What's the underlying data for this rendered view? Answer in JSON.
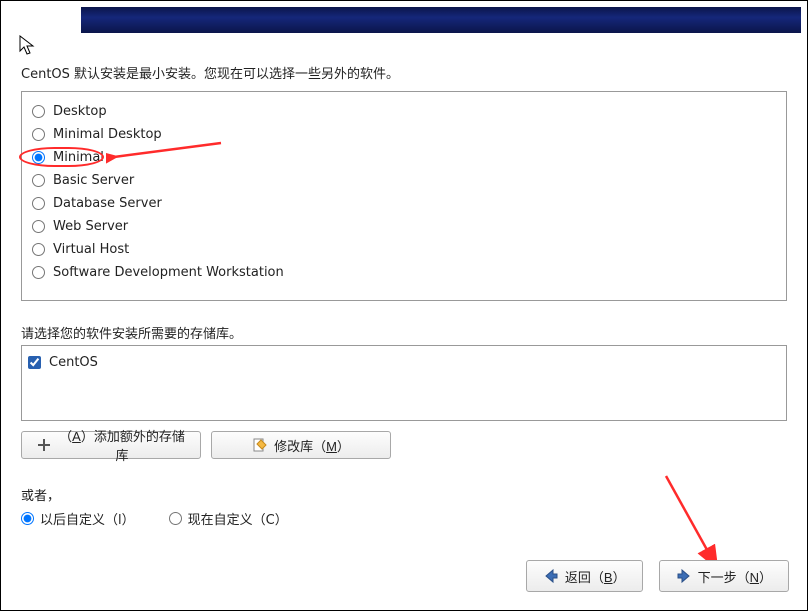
{
  "intro": "CentOS 默认安装是最小安装。您现在可以选择一些另外的软件。",
  "software_options": [
    {
      "label": "Desktop",
      "selected": false
    },
    {
      "label": "Minimal Desktop",
      "selected": false
    },
    {
      "label": "Minimal",
      "selected": true
    },
    {
      "label": "Basic Server",
      "selected": false
    },
    {
      "label": "Database Server",
      "selected": false
    },
    {
      "label": "Web Server",
      "selected": false
    },
    {
      "label": "Virtual Host",
      "selected": false
    },
    {
      "label": "Software Development Workstation",
      "selected": false
    }
  ],
  "repo_label": "请选择您的软件安装所需要的存储库。",
  "repos": [
    {
      "label": "CentOS",
      "checked": true
    }
  ],
  "add_repo_btn_prefix": "（",
  "add_repo_btn_key": "A",
  "add_repo_btn_suffix": "）添加额外的存储库",
  "modify_repo_btn_prefix": "修改库（",
  "modify_repo_btn_key": "M",
  "modify_repo_btn_suffix": "）",
  "or_label": "或者，",
  "customize_later_prefix": "以后自定义（",
  "customize_later_key": "l",
  "customize_later_suffix": "）",
  "customize_now_prefix": "现在自定义（",
  "customize_now_key": "C",
  "customize_now_suffix": "）",
  "customize_selected": "later",
  "back_btn_prefix": "返回（",
  "back_btn_key": "B",
  "back_btn_suffix": "）",
  "next_btn_prefix": "下一步（",
  "next_btn_key": "N",
  "next_btn_suffix": "）"
}
